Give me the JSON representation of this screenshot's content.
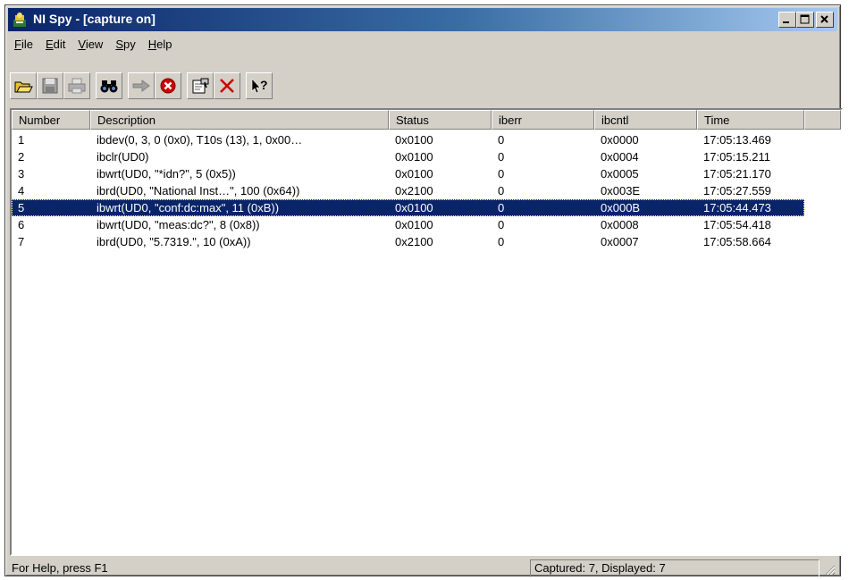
{
  "window": {
    "title": "NI Spy - [capture on]",
    "icon": "ni-spy-icon"
  },
  "title_buttons": [
    "minimize-icon",
    "maximize-icon",
    "close-icon"
  ],
  "menu": [
    {
      "label": "File",
      "mnemonic": "F"
    },
    {
      "label": "Edit",
      "mnemonic": "E"
    },
    {
      "label": "View",
      "mnemonic": "V"
    },
    {
      "label": "Spy",
      "mnemonic": "S"
    },
    {
      "label": "Help",
      "mnemonic": "H"
    }
  ],
  "toolbar": {
    "buttons": [
      "open-folder-icon",
      "save-icon",
      "print-icon",
      "find-binoculars-icon",
      "start-capture-arrow-icon",
      "stop-capture-icon",
      "properties-icon",
      "clear-delete-icon",
      "context-help-icon"
    ],
    "colors": {
      "accent_red": "#cc0000",
      "arrow_gray": "#a0a0a0"
    }
  },
  "table": {
    "columns": [
      "Number",
      "Description",
      "Status",
      "iberr",
      "ibcntl",
      "Time"
    ],
    "rows": [
      [
        "1",
        "ibdev(0, 3, 0 (0x0), T10s (13), 1, 0x00…",
        "0x0100",
        "0",
        "0x0000",
        "17:05:13.469"
      ],
      [
        "2",
        "ibclr(UD0)",
        "0x0100",
        "0",
        "0x0004",
        "17:05:15.211"
      ],
      [
        "3",
        "ibwrt(UD0, \"*idn?\", 5 (0x5))",
        "0x0100",
        "0",
        "0x0005",
        "17:05:21.170"
      ],
      [
        "4",
        "ibrd(UD0, \"National Inst…\", 100 (0x64))",
        "0x2100",
        "0",
        "0x003E",
        "17:05:27.559"
      ],
      [
        "5",
        "ibwrt(UD0, \"conf:dc:max\", 11 (0xB))",
        "0x0100",
        "0",
        "0x000B",
        "17:05:44.473"
      ],
      [
        "6",
        "ibwrt(UD0, \"meas:dc?\", 8 (0x8))",
        "0x0100",
        "0",
        "0x0008",
        "17:05:54.418"
      ],
      [
        "7",
        "ibrd(UD0, \"5.7319.\", 10 (0xA))",
        "0x2100",
        "0",
        "0x0007",
        "17:05:58.664"
      ]
    ],
    "selected_row": "5",
    "selection_color": "#0a246a"
  },
  "status": {
    "help_text": "For Help, press F1",
    "capture_text": "Captured: 7, Displayed: 7"
  }
}
